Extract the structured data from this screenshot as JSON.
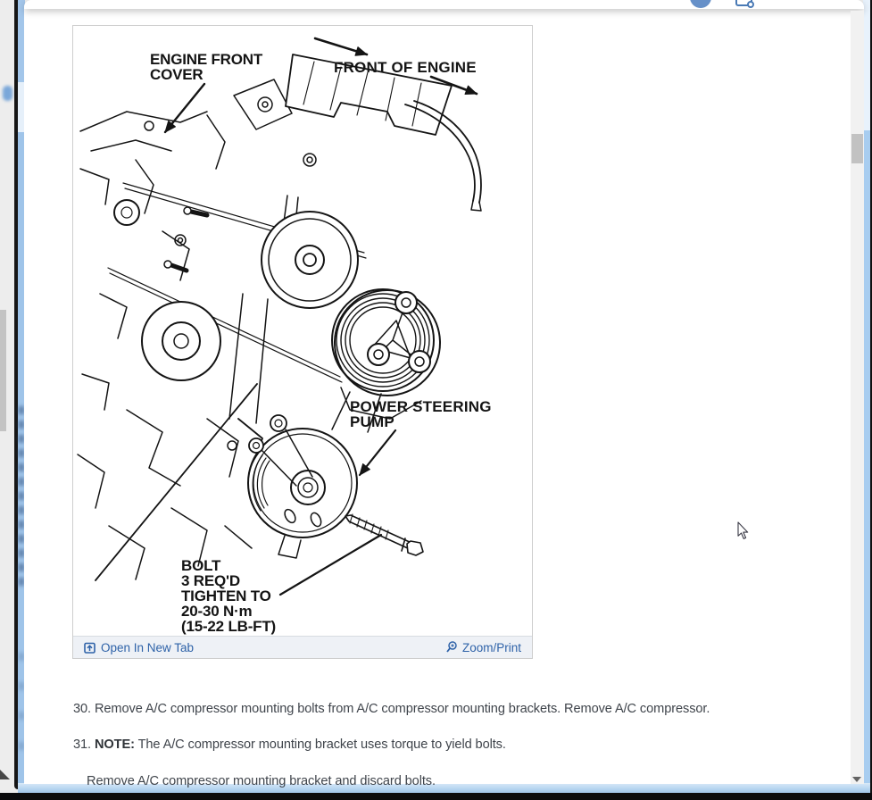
{
  "colors": {
    "link_blue": "#2e62a8",
    "frame_blue": "#a8cdf0",
    "diagram_ink": "#141414",
    "toolbar_icon_blue": "#6690c8",
    "body_text_gray": "#3f444b"
  },
  "toolbar": {
    "icons": [
      {
        "name": "avatar-icon"
      },
      {
        "name": "print-icon"
      }
    ]
  },
  "figure": {
    "labels": {
      "engine_front_cover_1": "ENGINE FRONT",
      "engine_front_cover_2": "COVER",
      "front_of_engine": "FRONT OF ENGINE",
      "power_steering_1": "POWER STEERING",
      "power_steering_2": "PUMP",
      "bolt_note": [
        "BOLT",
        "3 REQ'D",
        "TIGHTEN TO",
        "20-30 N·m",
        "(15-22 LB-FT)"
      ]
    },
    "footer": {
      "open_in_new_tab": "Open In New Tab",
      "zoom_print": "Zoom/Print"
    }
  },
  "steps": {
    "step30": {
      "number": "30.",
      "text": "Remove A/C compressor mounting bolts from A/C compressor mounting brackets. Remove A/C compressor."
    },
    "step31": {
      "number": "31.",
      "note_label": "NOTE:",
      "text": "The A/C compressor mounting bracket uses torque to yield bolts."
    },
    "continuation": "Remove A/C compressor mounting bracket and discard bolts."
  }
}
